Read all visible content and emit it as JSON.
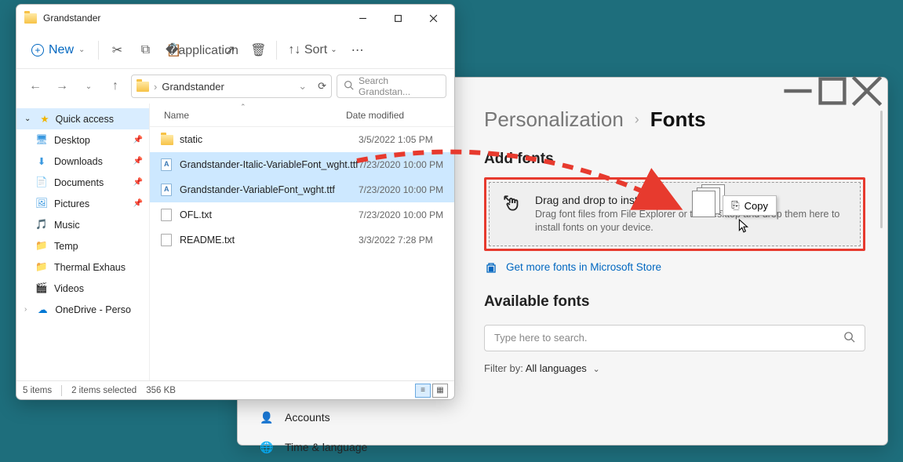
{
  "explorer": {
    "title": "Grandstander",
    "toolbar": {
      "new": "New",
      "sort": "Sort"
    },
    "path": "Grandstander",
    "search_placeholder": "Search Grandstan...",
    "columns": {
      "name": "Name",
      "date": "Date modified"
    },
    "sidebar": {
      "quick": "Quick access",
      "items": [
        {
          "label": "Desktop",
          "pin": true
        },
        {
          "label": "Downloads",
          "pin": true
        },
        {
          "label": "Documents",
          "pin": true
        },
        {
          "label": "Pictures",
          "pin": true
        },
        {
          "label": "Music",
          "pin": false
        },
        {
          "label": "Temp",
          "pin": false
        },
        {
          "label": "Thermal Exhaus",
          "pin": false
        },
        {
          "label": "Videos",
          "pin": false
        },
        {
          "label": "OneDrive - Perso",
          "pin": false
        }
      ]
    },
    "rows": [
      {
        "type": "folder",
        "name": "static",
        "date": "3/5/2022 1:05 PM",
        "sel": false
      },
      {
        "type": "ttf",
        "name": "Grandstander-Italic-VariableFont_wght.ttf",
        "date": "7/23/2020 10:00 PM",
        "sel": true
      },
      {
        "type": "ttf",
        "name": "Grandstander-VariableFont_wght.ttf",
        "date": "7/23/2020 10:00 PM",
        "sel": true
      },
      {
        "type": "file",
        "name": "OFL.txt",
        "date": "7/23/2020 10:00 PM",
        "sel": false
      },
      {
        "type": "file",
        "name": "README.txt",
        "date": "3/3/2022 7:28 PM",
        "sel": false
      }
    ],
    "status": {
      "count": "5 items",
      "selected": "2 items selected",
      "size": "356 KB"
    }
  },
  "settings": {
    "crumb_parent": "Personalization",
    "crumb_current": "Fonts",
    "side": [
      {
        "label": "Accounts"
      },
      {
        "label": "Time & language"
      }
    ],
    "add_heading": "Add fonts",
    "drop_title": "Drag and drop to install",
    "drop_sub": "Drag font files from File Explorer or the desktop and drop them here to install fonts on your device.",
    "store_link": "Get more fonts in Microsoft Store",
    "available_heading": "Available fonts",
    "search_placeholder": "Type here to search.",
    "filter_label": "Filter by:",
    "filter_value": "All languages",
    "copy_tip": "Copy"
  }
}
